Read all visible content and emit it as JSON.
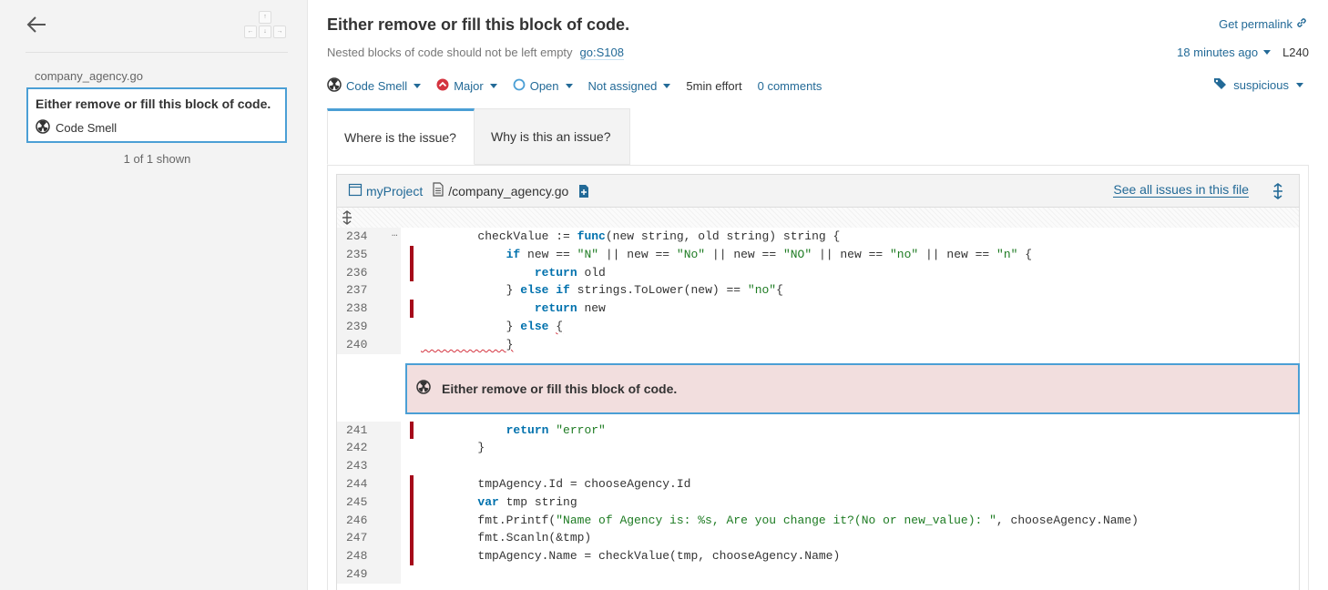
{
  "sidebar": {
    "file_name": "company_agency.go",
    "issue": {
      "title": "Either remove or fill this block of code.",
      "type": "Code Smell"
    },
    "count_text": "1 of 1 shown",
    "kbd_up": "↑",
    "kbd_left": "←",
    "kbd_down": "↓",
    "kbd_right": "→"
  },
  "issue": {
    "title": "Either remove or fill this block of code.",
    "permalink": "Get permalink",
    "description": "Nested blocks of code should not be left empty",
    "rule": "go:S108",
    "time_ago": "18 minutes ago",
    "line": "L240",
    "type": "Code Smell",
    "severity": "Major",
    "status": "Open",
    "assignee": "Not assigned",
    "effort": "5min effort",
    "comments": "0 comments",
    "tag": "suspicious"
  },
  "tabs": [
    {
      "label": "Where is the issue?"
    },
    {
      "label": "Why is this an issue?"
    }
  ],
  "viewer": {
    "project": "myProject",
    "file_path": "/company_agency.go",
    "see_all": "See all issues in this file",
    "dots": "…",
    "issue_message": "Either remove or fill this block of code.",
    "lines": [
      {
        "n": "234",
        "covered": false
      },
      {
        "n": "235",
        "covered": true
      },
      {
        "n": "236",
        "covered": true
      },
      {
        "n": "237",
        "covered": false
      },
      {
        "n": "238",
        "covered": true
      },
      {
        "n": "239",
        "covered": false
      },
      {
        "n": "240",
        "covered": false
      },
      {
        "n": "241",
        "covered": true
      },
      {
        "n": "242",
        "covered": false
      },
      {
        "n": "243",
        "covered": false
      },
      {
        "n": "244",
        "covered": true
      },
      {
        "n": "245",
        "covered": true
      },
      {
        "n": "246",
        "covered": true
      },
      {
        "n": "247",
        "covered": true
      },
      {
        "n": "248",
        "covered": true
      },
      {
        "n": "249",
        "covered": false
      }
    ],
    "code": {
      "l234_a": "        checkValue := ",
      "l234_kw": "func",
      "l234_b": "(new string, old string) string {",
      "l235_a": "            ",
      "l235_kw": "if",
      "l235_b": " new == ",
      "l235_s1": "\"N\"",
      "l235_c": " || new == ",
      "l235_s2": "\"No\"",
      "l235_d": " || new == ",
      "l235_s3": "\"NO\"",
      "l235_e": " || new == ",
      "l235_s4": "\"no\"",
      "l235_f": " || new == ",
      "l235_s5": "\"n\"",
      "l235_g": " {",
      "l236_a": "                ",
      "l236_kw": "return",
      "l236_b": " old",
      "l237_a": "            } ",
      "l237_kw1": "else",
      "l237_sp": " ",
      "l237_kw2": "if",
      "l237_b": " strings.ToLower(new) == ",
      "l237_s": "\"no\"",
      "l237_c": "{",
      "l238_a": "                ",
      "l238_kw": "return",
      "l238_b": " new",
      "l239_a": "            } ",
      "l239_kw": "else",
      "l239_sp": " ",
      "l239_brace": "{",
      "l240_a": "            ",
      "l240_brace": "}",
      "l241_a": "            ",
      "l241_kw": "return",
      "l241_sp": " ",
      "l241_s": "\"error\"",
      "l242": "        }",
      "l243": "",
      "l244": "        tmpAgency.Id = chooseAgency.Id",
      "l245_a": "        ",
      "l245_kw": "var",
      "l245_b": " tmp string",
      "l246_a": "        fmt.Printf(",
      "l246_s": "\"Name of Agency is: %s, Are you change it?(No or new_value): \"",
      "l246_b": ", chooseAgency.Name)",
      "l247": "        fmt.Scanln(&tmp)",
      "l248": "        tmpAgency.Name = checkValue(tmp, chooseAgency.Name)",
      "l249": ""
    }
  },
  "colors": {
    "accent": "#4b9fd5",
    "link": "#236a97",
    "covered": "#a5091a",
    "issue_bg": "#f2dede",
    "major": "#d4333f"
  }
}
